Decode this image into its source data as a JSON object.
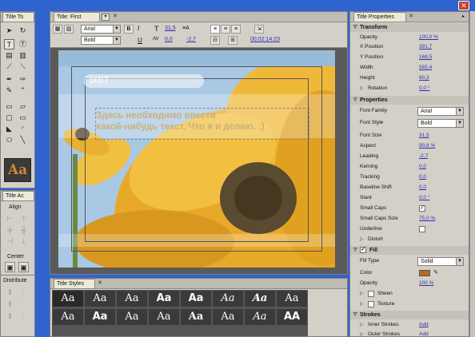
{
  "tools_panel": {
    "tab": "Title To"
  },
  "title_panel": {
    "tab": "Title: First",
    "font_family": "Arial",
    "font_style": "Bold",
    "bold_label": "B",
    "italic_label": "I",
    "underline_label": "U",
    "font_size": "31,5",
    "kerning": "0,0",
    "leading": "-2,7",
    "timecode": "00:02:14:23"
  },
  "canvas": {
    "header_text": "IXBT",
    "main_text_line1": "Здесь необходимо ввести",
    "main_text_line2": "какой-нибудь текст. Что я и делаю.  :)"
  },
  "title_actions": {
    "tab": "Title Ac",
    "align": "Align",
    "center": "Center",
    "distribute": "Distribute"
  },
  "title_styles": {
    "tab": "Title Styles",
    "swatches": [
      "Aa",
      "Aa",
      "Aa",
      "Aa",
      "Aa",
      "Aa",
      "Aa",
      "Aa",
      "Aa",
      "Aa",
      "Aa",
      "Aa",
      "Aa",
      "Aa",
      "Aa",
      "AA"
    ]
  },
  "properties": {
    "tab": "Title Properties",
    "transform": {
      "label": "Transform",
      "rows": [
        {
          "label": "Opacity",
          "value": "100,0 %"
        },
        {
          "label": "X Position",
          "value": "391,7"
        },
        {
          "label": "Y Position",
          "value": "168,5"
        },
        {
          "label": "Width",
          "value": "565,4"
        },
        {
          "label": "Height",
          "value": "60,3"
        },
        {
          "label": "Rotation",
          "value": "0,0 °"
        }
      ]
    },
    "props": {
      "label": "Properties",
      "font_family": {
        "label": "Font Family",
        "value": "Arial"
      },
      "font_style": {
        "label": "Font Style",
        "value": "Bold"
      },
      "rows": [
        {
          "label": "Font Size",
          "value": "31,5"
        },
        {
          "label": "Aspect",
          "value": "90,8 %"
        },
        {
          "label": "Leading",
          "value": "-2,7"
        },
        {
          "label": "Kerning",
          "value": "0,0"
        },
        {
          "label": "Tracking",
          "value": "0,0"
        },
        {
          "label": "Baseline Shift",
          "value": "0,0"
        },
        {
          "label": "Slant",
          "value": "0,0 °"
        }
      ],
      "small_caps": "Small Caps",
      "small_caps_size": {
        "label": "Small Caps Size",
        "value": "75,0 %"
      },
      "underline": "Underline",
      "distort": "Distort"
    },
    "fill": {
      "label": "Fill",
      "fill_type": {
        "label": "Fill Type",
        "value": "Solid"
      },
      "color": {
        "label": "Color",
        "value": "#b86a1e"
      },
      "opacity": {
        "label": "Opacity",
        "value": "100 %"
      },
      "sheen": "Sheen",
      "texture": "Texture"
    },
    "strokes": {
      "label": "Strokes",
      "inner": {
        "label": "Inner Strokes",
        "value": "Add"
      },
      "outer": {
        "label": "Outer Strokes",
        "value": "Add"
      }
    }
  },
  "colors": {
    "window_bg": "#2f63d0",
    "text_color": "#c8b080",
    "accent_link": "#3030b0"
  }
}
